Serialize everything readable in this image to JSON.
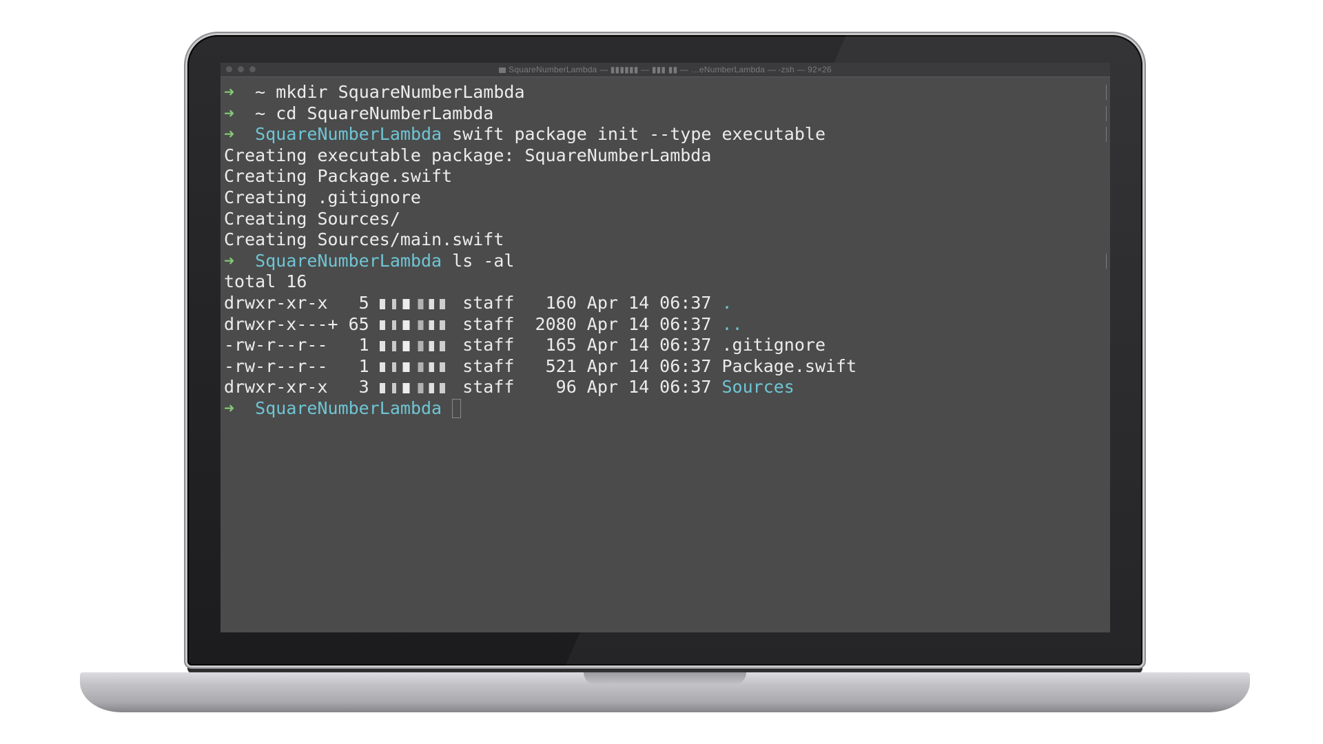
{
  "window": {
    "title": "SquareNumberLambda — ▮▮▮▮▮▮ — ▮▮▮ ▮▮ — …eNumberLambda — -zsh — 92×26"
  },
  "terminal": {
    "colors": {
      "background": "#4b4b4b",
      "text": "#ececec",
      "prompt_arrow": "#83c774",
      "directory": "#6fc5d4"
    },
    "arrow": "➜",
    "lines": [
      {
        "cwd": "~",
        "cmd": " mkdir SquareNumberLambda"
      },
      {
        "cwd": "~",
        "cmd": " cd SquareNumberLambda"
      },
      {
        "cwd": "SquareNumberLambda",
        "cmd": " swift package init --type executable"
      },
      {
        "text": "Creating executable package: SquareNumberLambda"
      },
      {
        "text": "Creating Package.swift"
      },
      {
        "text": "Creating .gitignore"
      },
      {
        "text": "Creating Sources/"
      },
      {
        "text": "Creating Sources/main.swift"
      },
      {
        "cwd": "SquareNumberLambda",
        "cmd": " ls -al"
      },
      {
        "text": "total 16"
      }
    ],
    "listing": [
      {
        "perms": "drwxr-xr-x   5",
        "group": " staff   160 Apr 14 06:37 ",
        "name": ".",
        "is_dir": true
      },
      {
        "perms": "drwxr-x---+ 65",
        "group": " staff  2080 Apr 14 06:37 ",
        "name": "..",
        "is_dir": true
      },
      {
        "perms": "-rw-r--r--   1",
        "group": " staff   165 Apr 14 06:37 ",
        "name": ".gitignore",
        "is_dir": false
      },
      {
        "perms": "-rw-r--r--   1",
        "group": " staff   521 Apr 14 06:37 ",
        "name": "Package.swift",
        "is_dir": false
      },
      {
        "perms": "drwxr-xr-x   3",
        "group": " staff    96 Apr 14 06:37 ",
        "name": "Sources",
        "is_dir": true
      }
    ],
    "final_prompt": {
      "cwd": "SquareNumberLambda"
    }
  }
}
